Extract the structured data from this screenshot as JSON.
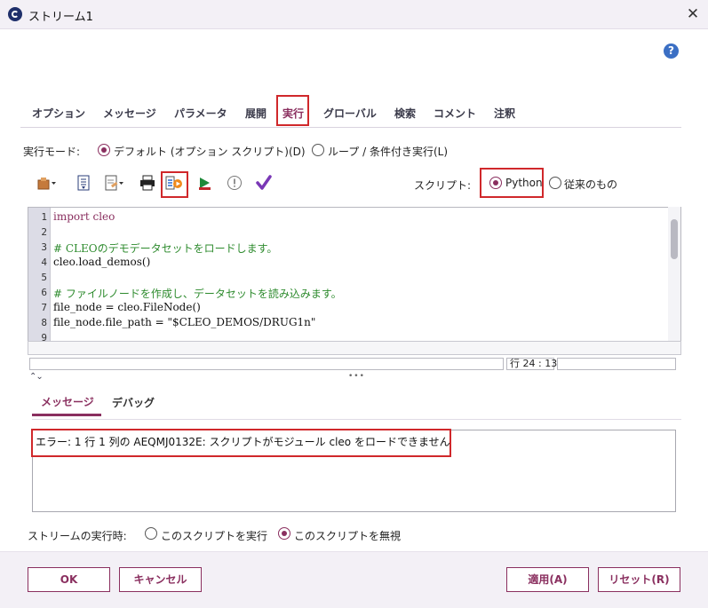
{
  "window": {
    "title": "ストリーム1",
    "close_label": "✕",
    "help_label": "?"
  },
  "tabs": [
    {
      "label": "オプション"
    },
    {
      "label": "メッセージ"
    },
    {
      "label": "パラメータ"
    },
    {
      "label": "展開"
    },
    {
      "label": "実行",
      "active": true
    },
    {
      "label": "グローバル"
    },
    {
      "label": "検索"
    },
    {
      "label": "コメント"
    },
    {
      "label": "注釈"
    }
  ],
  "exec_mode": {
    "label": "実行モード:",
    "options": [
      {
        "label": "デフォルト (オプション スクリプト)(D)",
        "selected": true
      },
      {
        "label": "ループ / 条件付き実行(L)",
        "selected": false
      }
    ]
  },
  "toolbar": {
    "icons": [
      "import-script-icon",
      "save-script-icon",
      "edit-script-icon",
      "print-icon",
      "run-selected-lines-icon",
      "run-script-icon",
      "check-syntax-icon",
      "verify-icon"
    ]
  },
  "script_type": {
    "label": "スクリプト:",
    "options": [
      {
        "label": "Python",
        "selected": true
      },
      {
        "label": "従来のもの",
        "selected": false
      }
    ]
  },
  "editor": {
    "lines": [
      {
        "n": "1",
        "text": "import cleo"
      },
      {
        "n": "2",
        "text": ""
      },
      {
        "n": "3",
        "text": "# CLEOのデモデータセットをロードします。"
      },
      {
        "n": "4",
        "text": "cleo.load_demos()"
      },
      {
        "n": "5",
        "text": ""
      },
      {
        "n": "6",
        "text": "# ファイルノードを作成し、データセットを読み込みます。"
      },
      {
        "n": "7",
        "text": "file_node = cleo.FileNode()"
      },
      {
        "n": "8",
        "text": "file_node.file_path = \"$CLEO_DEMOS/DRUG1n\""
      },
      {
        "n": "9",
        "text": ""
      }
    ],
    "status_position": "行 24 : 13",
    "splitter_handle": "•••",
    "collapse_icons": "⌃⌄"
  },
  "messages": {
    "tabs": [
      {
        "label": "メッセージ",
        "active": true
      },
      {
        "label": "デバッグ"
      }
    ],
    "error_text": "エラー: 1 行 1 列の AEQMJ0132E: スクリプトがモジュール cleo をロードできません"
  },
  "on_stream_run": {
    "label": "ストリームの実行時:",
    "options": [
      {
        "label": "このスクリプトを実行",
        "selected": false
      },
      {
        "label": "このスクリプトを無視",
        "selected": true
      }
    ]
  },
  "buttons": {
    "ok": "OK",
    "cancel": "キャンセル",
    "apply": "適用(A)",
    "reset": "リセット(R)"
  },
  "colors": {
    "accent": "#8a2f5f",
    "highlight": "#d0282b",
    "help": "#3b6fc4",
    "comment": "#2e8b2e"
  }
}
